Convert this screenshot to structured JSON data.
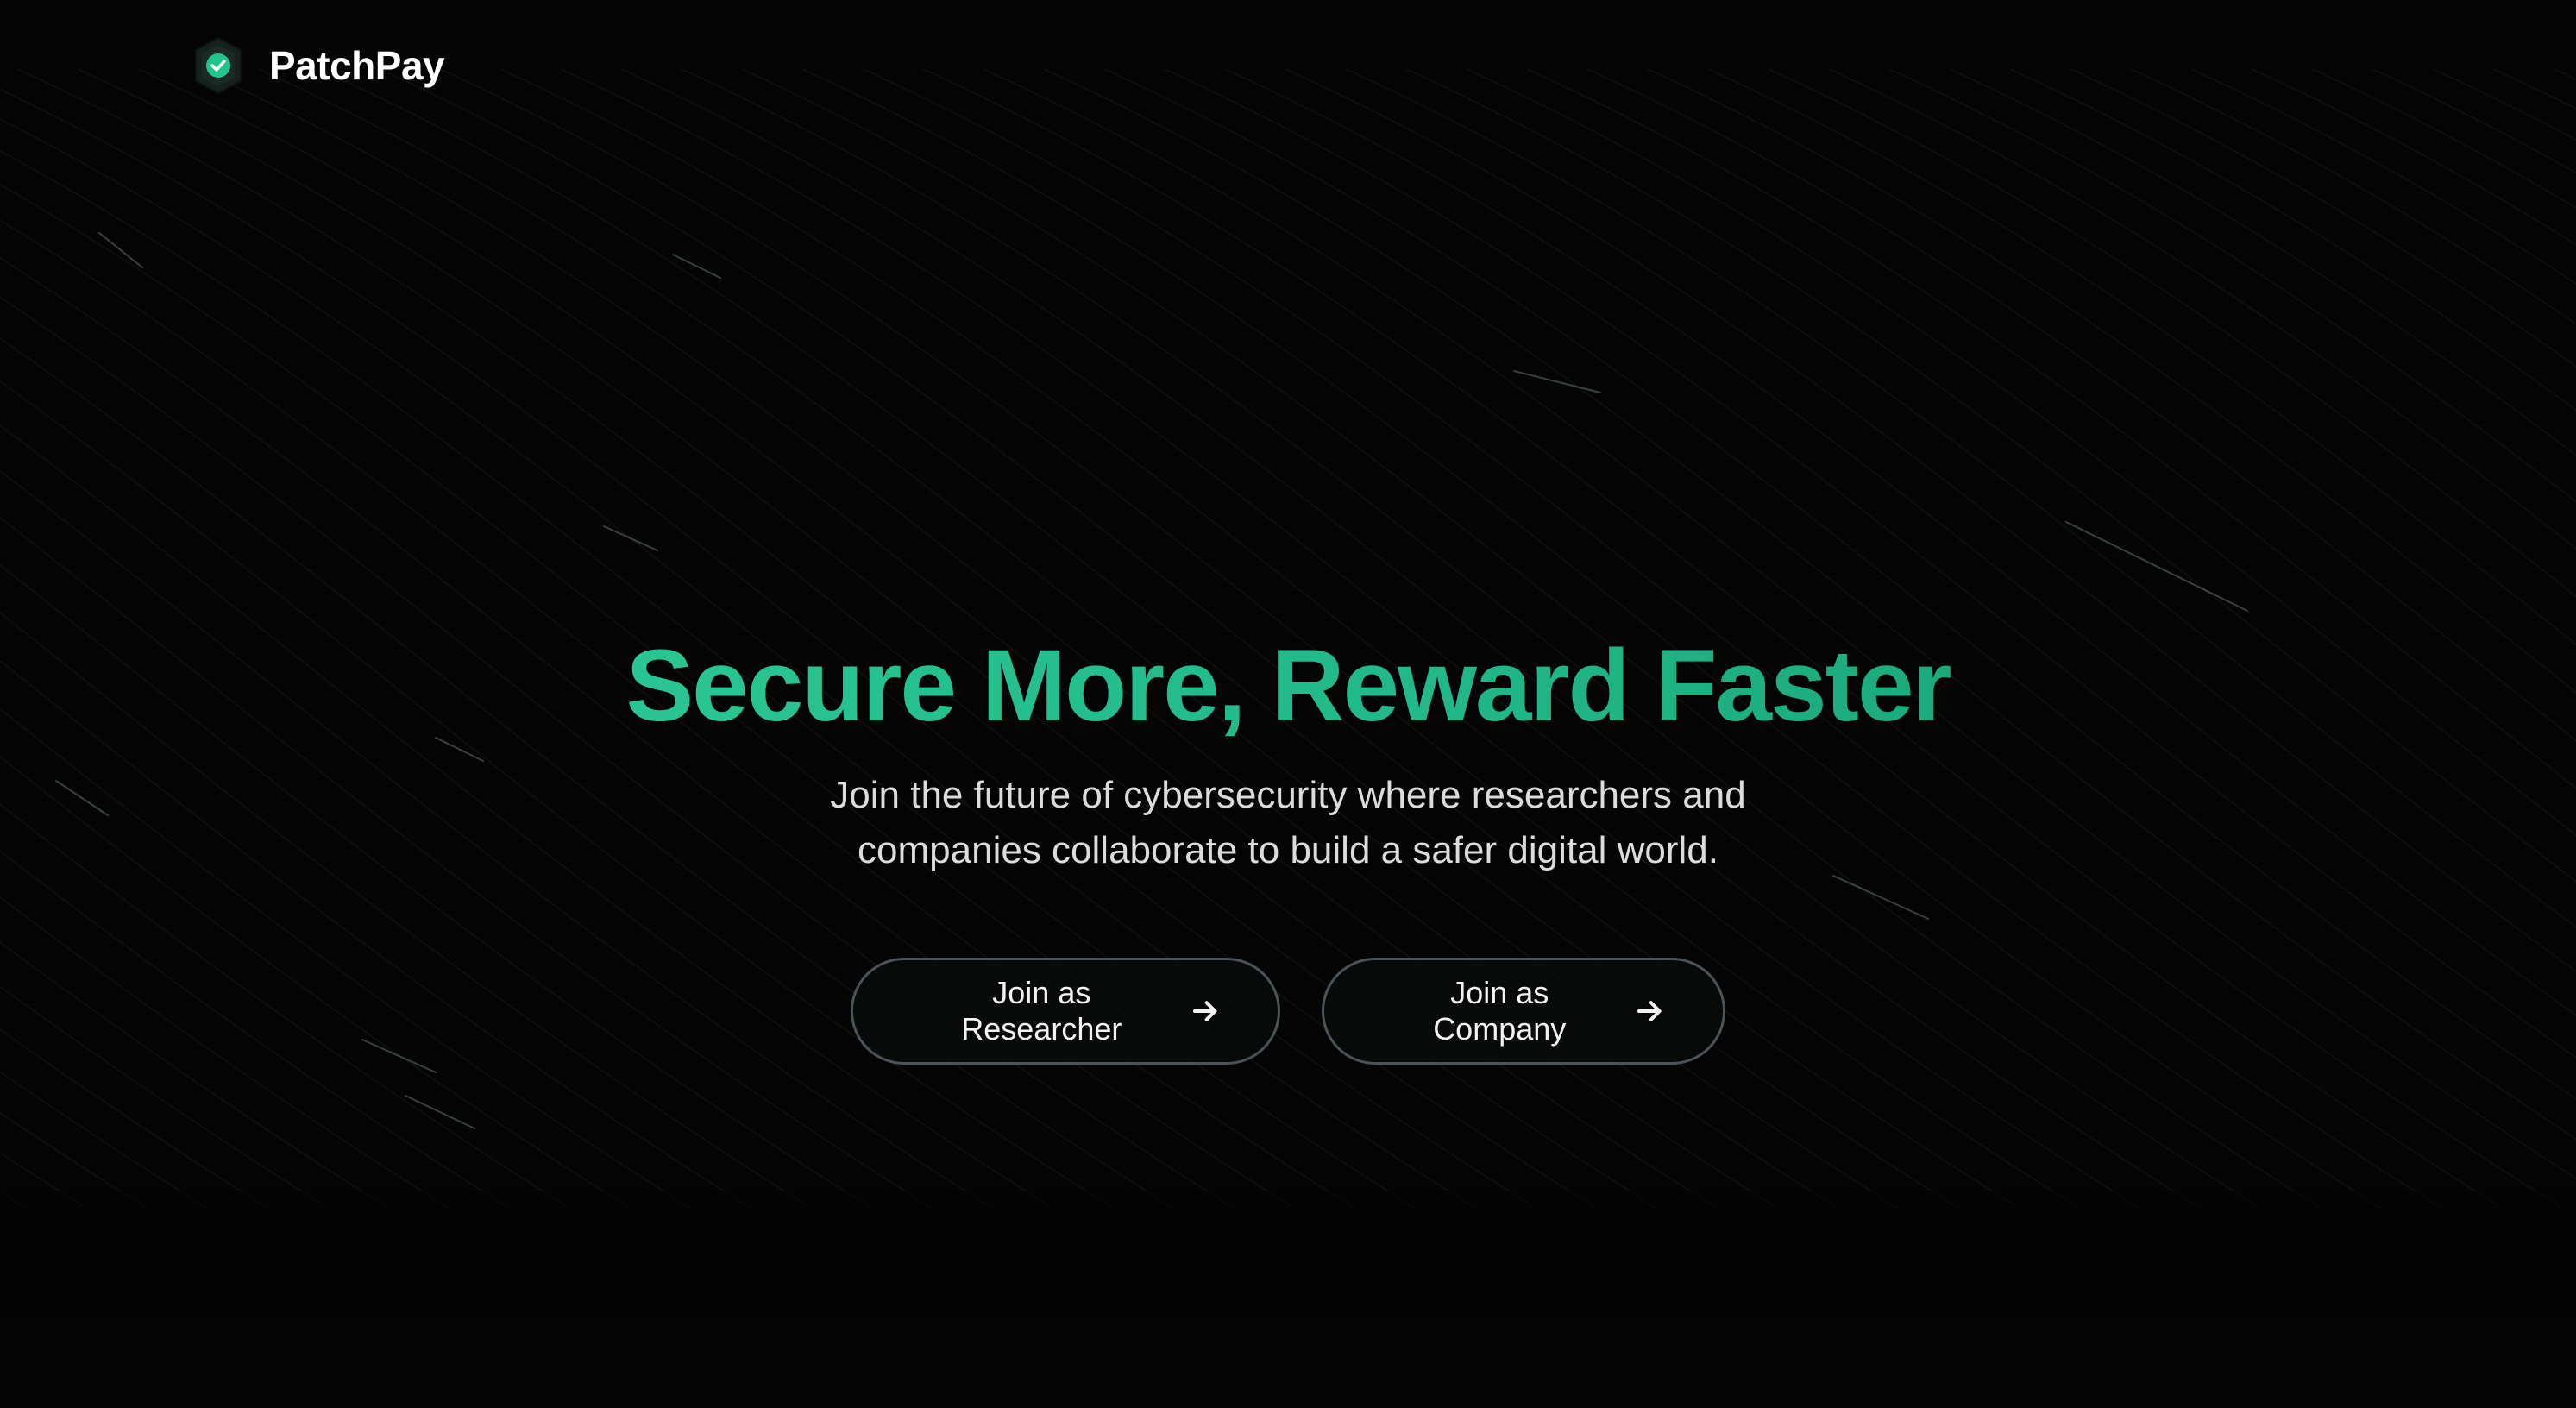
{
  "brand": {
    "name": "PatchPay",
    "logo_icon": "shield-check-icon",
    "accent": "#22c48e"
  },
  "hero": {
    "headline": "Secure More, Reward Faster",
    "subtitle": "Join the future of cybersecurity where researchers and companies collaborate to build a safer digital world.",
    "headline_gradient": [
      "#2fd09b",
      "#149a6d"
    ]
  },
  "cta": {
    "researcher_label": "Join as Researcher",
    "company_label": "Join as Company",
    "arrow_icon": "arrow-right-icon"
  },
  "colors": {
    "background": "#040404",
    "button_border": "#4a5358",
    "text": "#dcdcdc"
  }
}
